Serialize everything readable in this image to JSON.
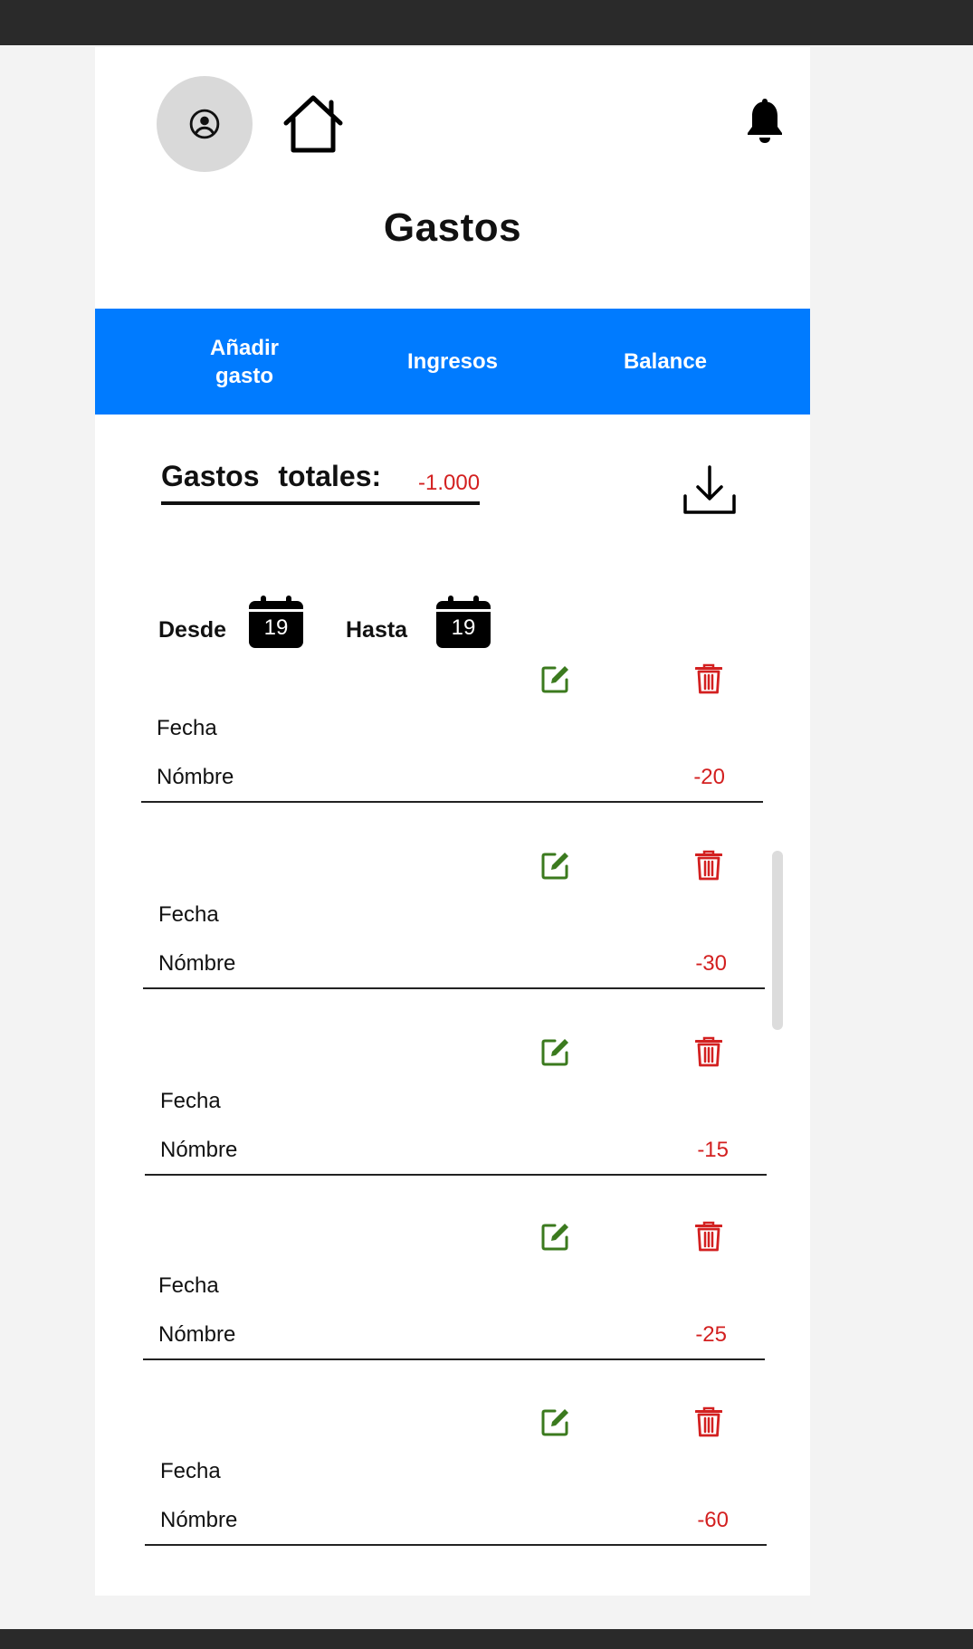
{
  "header": {
    "title": "Gastos",
    "icons": {
      "profile": "user-circle-icon",
      "home": "home-icon",
      "notifications": "bell-icon"
    }
  },
  "nav": {
    "add_expense": "Añadir gasto",
    "income": "Ingresos",
    "balance": "Balance",
    "color": "#007bff"
  },
  "summary": {
    "label": "Gastos totales:",
    "total": "-1.000",
    "download_icon": "download-icon"
  },
  "range": {
    "from_label": "Desde",
    "from_day": "19",
    "to_label": "Hasta",
    "to_day": "19"
  },
  "expenses": [
    {
      "date": "Fecha",
      "name": "Nómbre",
      "amount": "-20"
    },
    {
      "date": "Fecha",
      "name": "Nómbre",
      "amount": "-30"
    },
    {
      "date": "Fecha",
      "name": "Nómbre",
      "amount": "-15"
    },
    {
      "date": "Fecha",
      "name": "Nómbre",
      "amount": "-25"
    },
    {
      "date": "Fecha",
      "name": "Nómbre",
      "amount": "-60"
    }
  ],
  "colors": {
    "negative": "#d32020",
    "edit": "#3b7a1e",
    "delete": "#d32020"
  }
}
